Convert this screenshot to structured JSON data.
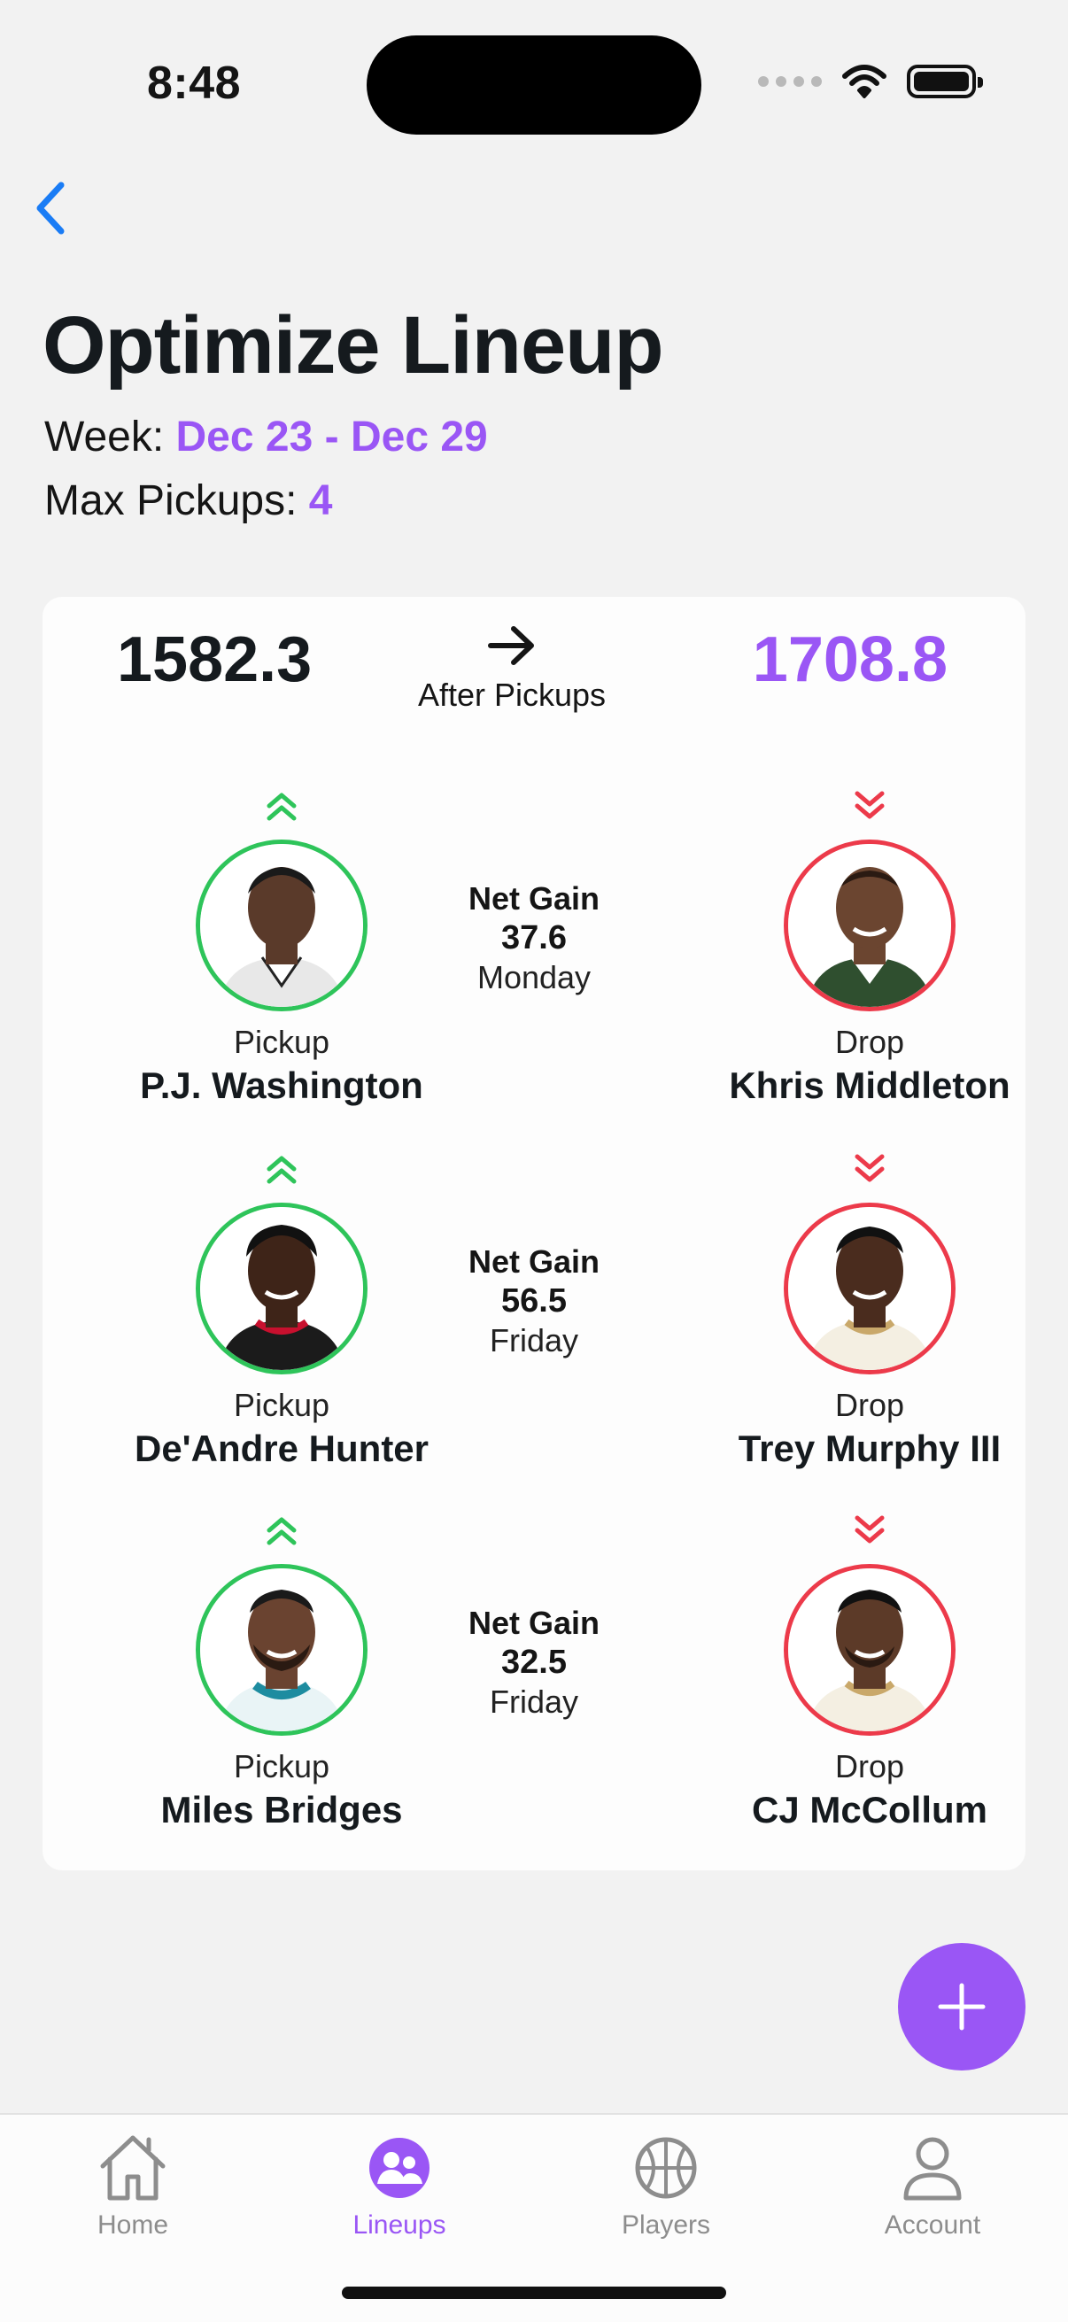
{
  "status_bar": {
    "time": "8:48"
  },
  "header": {
    "title": "Optimize Lineup",
    "week_label": "Week:",
    "week_value": "Dec 23 - Dec 29",
    "max_pickups_label": "Max Pickups:",
    "max_pickups_value": "4"
  },
  "summary": {
    "before": "1582.3",
    "after": "1708.8",
    "after_label": "After Pickups"
  },
  "swaps": [
    {
      "pickup": {
        "role": "Pickup",
        "name": "P.J. Washington"
      },
      "drop": {
        "role": "Drop",
        "name": "Khris Middleton"
      },
      "gain_label": "Net Gain",
      "gain_value": "37.6",
      "day": "Monday"
    },
    {
      "pickup": {
        "role": "Pickup",
        "name": "De'Andre Hunter"
      },
      "drop": {
        "role": "Drop",
        "name": "Trey Murphy III"
      },
      "gain_label": "Net Gain",
      "gain_value": "56.5",
      "day": "Friday"
    },
    {
      "pickup": {
        "role": "Pickup",
        "name": "Miles Bridges"
      },
      "drop": {
        "role": "Drop",
        "name": "CJ McCollum"
      },
      "gain_label": "Net Gain",
      "gain_value": "32.5",
      "day": "Friday"
    }
  ],
  "tabs": [
    {
      "label": "Home",
      "icon": "home-icon",
      "active": false
    },
    {
      "label": "Lineups",
      "icon": "lineups-icon",
      "active": true
    },
    {
      "label": "Players",
      "icon": "basketball-icon",
      "active": false
    },
    {
      "label": "Account",
      "icon": "person-icon",
      "active": false
    }
  ],
  "colors": {
    "accent": "#9a56f5",
    "pickup": "#2ec45a",
    "drop": "#ec3a4a",
    "back": "#1a7cf5"
  }
}
